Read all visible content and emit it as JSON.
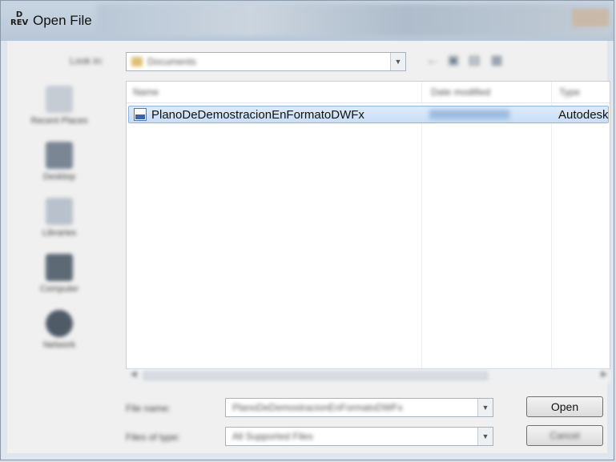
{
  "window": {
    "title": "Open File",
    "app_icon_text": "D\nREV"
  },
  "look_in": {
    "label": "Look in:",
    "value": "Documents"
  },
  "places": [
    {
      "label": "Recent Places",
      "icon": "recent-places-icon"
    },
    {
      "label": "Desktop",
      "icon": "desktop-icon"
    },
    {
      "label": "Libraries",
      "icon": "libraries-icon"
    },
    {
      "label": "Computer",
      "icon": "computer-icon"
    },
    {
      "label": "Network",
      "icon": "network-icon"
    }
  ],
  "file_list": {
    "columns": {
      "name": "Name",
      "date": "Date modified",
      "type": "Type"
    },
    "rows": [
      {
        "name": "PlanoDeDemostracionEnFormatoDWFx",
        "type": "Autodesk",
        "selected": true
      }
    ]
  },
  "file_name": {
    "label": "File name:",
    "value": "PlanoDeDemostracionEnFormatoDWFx"
  },
  "file_type": {
    "label": "Files of type:",
    "value": "All Supported Files"
  },
  "buttons": {
    "open": "Open",
    "cancel": "Cancel"
  },
  "colors": {
    "selection": "#c9def5",
    "selection_border": "#8fb6e2",
    "title_bar": "#b8c7d7"
  }
}
